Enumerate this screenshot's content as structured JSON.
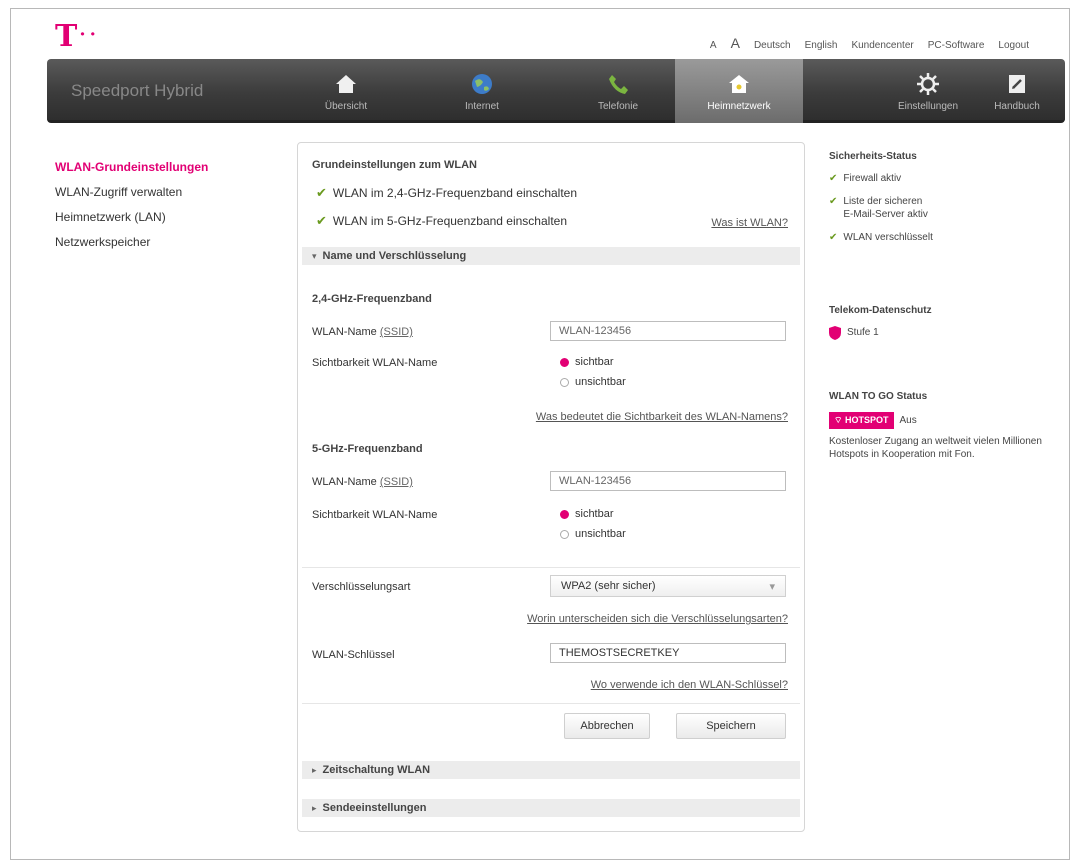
{
  "brand": {
    "logo_text": "T",
    "name": "Speedport Hybrid"
  },
  "toplinks": {
    "font_small": "A",
    "font_large": "A",
    "lang_de": "Deutsch",
    "lang_en": "English",
    "customer_center": "Kundencenter",
    "pc_software": "PC-Software",
    "logout": "Logout"
  },
  "nav": {
    "items": [
      {
        "label": "Übersicht",
        "icon": "home-icon"
      },
      {
        "label": "Internet",
        "icon": "globe-icon"
      },
      {
        "label": "Telefonie",
        "icon": "phone-icon"
      },
      {
        "label": "Heimnetzwerk",
        "icon": "network-icon",
        "active": true
      },
      {
        "label": "Einstellungen",
        "icon": "gear-icon"
      },
      {
        "label": "Handbuch",
        "icon": "manual-icon"
      }
    ]
  },
  "sidebar": {
    "items": [
      {
        "label": "WLAN-Grundeinstellungen",
        "active": true
      },
      {
        "label": "WLAN-Zugriff verwalten"
      },
      {
        "label": "Heimnetzwerk (LAN)"
      },
      {
        "label": "Netzwerkspeicher"
      }
    ]
  },
  "main": {
    "title": "Grundeinstellungen zum WLAN",
    "wlan24_checkbox": "WLAN im 2,4-GHz-Frequenzband einschalten",
    "wlan5_checkbox": "WLAN im 5-GHz-Frequenzband einschalten",
    "what_is_wlan_link": "Was ist WLAN?",
    "section_name": "Name und Verschlüsselung",
    "band24": {
      "title": "2,4-GHz-Frequenzband",
      "name_label": "WLAN-Name",
      "name_label_ssid": "(SSID)",
      "name_value": "WLAN-123456",
      "visibility_label": "Sichtbarkeit WLAN-Name",
      "visible": "sichtbar",
      "invisible": "unsichtbar",
      "visibility_link": "Was bedeutet die Sichtbarkeit des WLAN-Namens?"
    },
    "band5": {
      "title": "5-GHz-Frequenzband",
      "name_label": "WLAN-Name",
      "name_label_ssid": "(SSID)",
      "name_value": "WLAN-123456",
      "visibility_label": "Sichtbarkeit WLAN-Name",
      "visible": "sichtbar",
      "invisible": "unsichtbar"
    },
    "encryption_label": "Verschlüsselungsart",
    "encryption_value": "WPA2 (sehr sicher)",
    "encryption_link": "Worin unterscheiden sich die Verschlüsselungsarten?",
    "key_label": "WLAN-Schlüssel",
    "key_value": "THEMOSTSECRETKEY",
    "key_link": "Wo verwende ich den WLAN-Schlüssel?",
    "cancel_button": "Abbrechen",
    "save_button": "Speichern",
    "section_timer": "Zeitschaltung WLAN",
    "section_transmit": "Sendeeinstellungen"
  },
  "right": {
    "security_title": "Sicherheits-Status",
    "firewall": "Firewall aktiv",
    "mail_line1": "Liste der sicheren",
    "mail_line2": "E-Mail-Server aktiv",
    "wlan_encrypted": "WLAN verschlüsselt",
    "privacy_title": "Telekom-Datenschutz",
    "privacy_level": "Stufe 1",
    "togo_title": "WLAN TO GO Status",
    "hotspot_badge": "HOTSPOT",
    "hotspot_state": "Aus",
    "togo_text": "Kostenloser Zugang an weltweit vielen Millionen Hotspots in Kooperation mit Fon."
  },
  "colors": {
    "accent": "#e20074",
    "check": "#6a9a1f"
  }
}
